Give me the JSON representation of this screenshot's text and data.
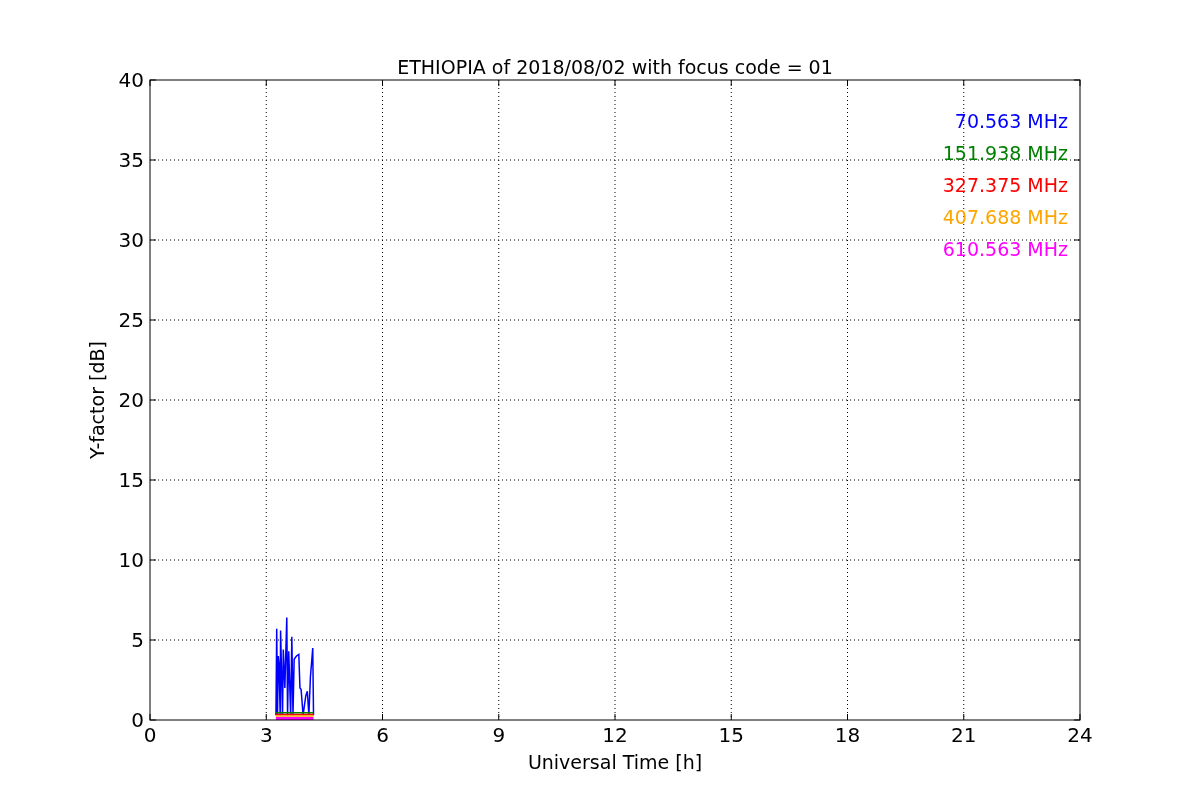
{
  "chart_data": {
    "type": "line",
    "title": "ETHIOPIA of 2018/08/02 with focus code = 01",
    "xlabel": "Universal Time [h]",
    "ylabel": "Y-factor [dB]",
    "xlim": [
      0,
      24
    ],
    "ylim": [
      0,
      40
    ],
    "xticks": [
      0,
      3,
      6,
      9,
      12,
      15,
      18,
      21,
      24
    ],
    "yticks": [
      0,
      5,
      10,
      15,
      20,
      25,
      30,
      35,
      40
    ],
    "grid": true,
    "x": [
      3.25,
      3.27,
      3.29,
      3.31,
      3.33,
      3.36,
      3.37,
      3.42,
      3.44,
      3.48,
      3.53,
      3.55,
      3.58,
      3.63,
      3.66,
      3.69,
      3.72,
      3.78,
      3.84,
      3.87,
      3.9,
      3.95,
      4.02,
      4.06,
      4.1,
      4.14,
      4.2,
      4.22
    ],
    "series": [
      {
        "name": "70.563 MHz",
        "color": "#0000ff",
        "values": [
          0.3,
          5.7,
          0.3,
          4.0,
          3.5,
          0.3,
          5.6,
          0.3,
          4.4,
          2.0,
          6.4,
          0.3,
          4.3,
          0.3,
          5.2,
          0.3,
          3.8,
          4.0,
          4.1,
          2.0,
          1.9,
          0.3,
          1.5,
          1.8,
          0.3,
          2.7,
          4.5,
          0.3
        ]
      },
      {
        "name": "151.938 MHz",
        "color": "#008000",
        "values": [
          0.45,
          0.45,
          0.45,
          0.45,
          0.45,
          0.45,
          0.45,
          0.45,
          0.45,
          0.45,
          0.45,
          0.45,
          0.45,
          0.45,
          0.45,
          0.45,
          0.45,
          0.45,
          0.45,
          0.45,
          0.45,
          0.45,
          0.45,
          0.45,
          0.45,
          0.45,
          0.45,
          0.45
        ]
      },
      {
        "name": "327.375 MHz",
        "color": "#ff0000",
        "values": [
          0.35,
          0.35,
          0.35,
          0.35,
          0.35,
          0.35,
          0.35,
          0.35,
          0.35,
          0.35,
          0.35,
          0.35,
          0.35,
          0.35,
          0.35,
          0.35,
          0.35,
          0.35,
          0.35,
          0.35,
          0.35,
          0.35,
          0.35,
          0.35,
          0.35,
          0.35,
          0.35,
          0.35
        ]
      },
      {
        "name": "407.688 MHz",
        "color": "#ffa500",
        "values": [
          0.25,
          0.25,
          0.25,
          0.25,
          0.25,
          0.25,
          0.25,
          0.25,
          0.25,
          0.25,
          0.25,
          0.25,
          0.25,
          0.25,
          0.25,
          0.25,
          0.25,
          0.25,
          0.25,
          0.25,
          0.25,
          0.25,
          0.25,
          0.25,
          0.25,
          0.25,
          0.25,
          0.25
        ]
      },
      {
        "name": "610.563 MHz",
        "color": "#ff00ff",
        "values": [
          0.1,
          0.1,
          0.1,
          0.1,
          0.1,
          0.1,
          0.1,
          0.1,
          0.1,
          0.1,
          0.1,
          0.1,
          0.1,
          0.1,
          0.1,
          0.1,
          0.1,
          0.1,
          0.1,
          0.1,
          0.1,
          0.1,
          0.1,
          0.1,
          0.1,
          0.1,
          0.1,
          0.1
        ]
      }
    ]
  }
}
